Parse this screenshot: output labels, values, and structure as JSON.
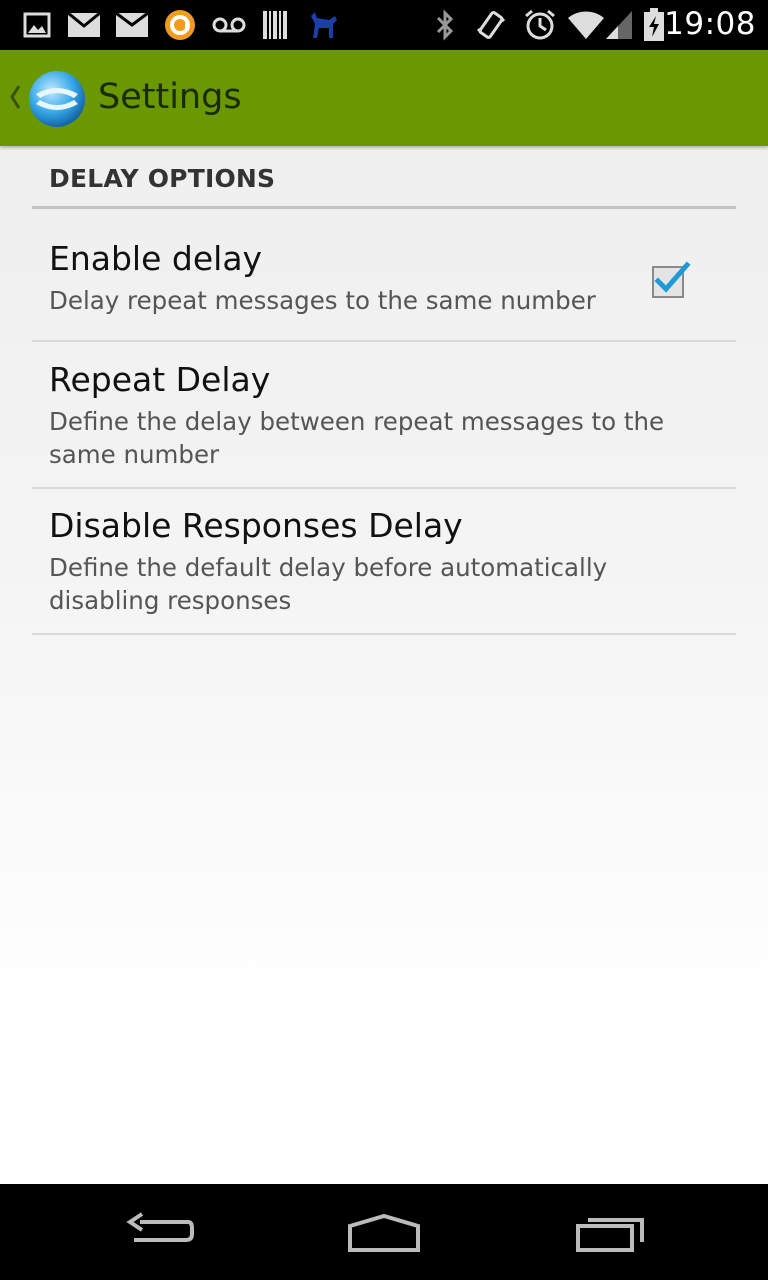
{
  "status_bar": {
    "time": "19:08",
    "icons": [
      "gallery-icon",
      "gmail-icon",
      "email-icon",
      "amazon-icon",
      "voicemail-icon",
      "barcode-icon",
      "dog-icon",
      "bluetooth-icon",
      "vibrate-icon",
      "alarm-icon",
      "wifi-icon",
      "signal-icon",
      "battery-charging-icon"
    ]
  },
  "action_bar": {
    "title": "Settings",
    "color": "#699803"
  },
  "preferences": {
    "section_header": "DELAY OPTIONS",
    "items": [
      {
        "title": "Enable delay",
        "summary": "Delay repeat messages to the same number",
        "checked": true
      },
      {
        "title": "Repeat Delay",
        "summary": "Define the delay between repeat messages to the same number"
      },
      {
        "title": "Disable Responses Delay",
        "summary": "Define the default delay before automatically disabling responses"
      }
    ]
  },
  "nav_bar": {
    "buttons": [
      "back-icon",
      "home-icon",
      "recent-apps-icon"
    ]
  }
}
